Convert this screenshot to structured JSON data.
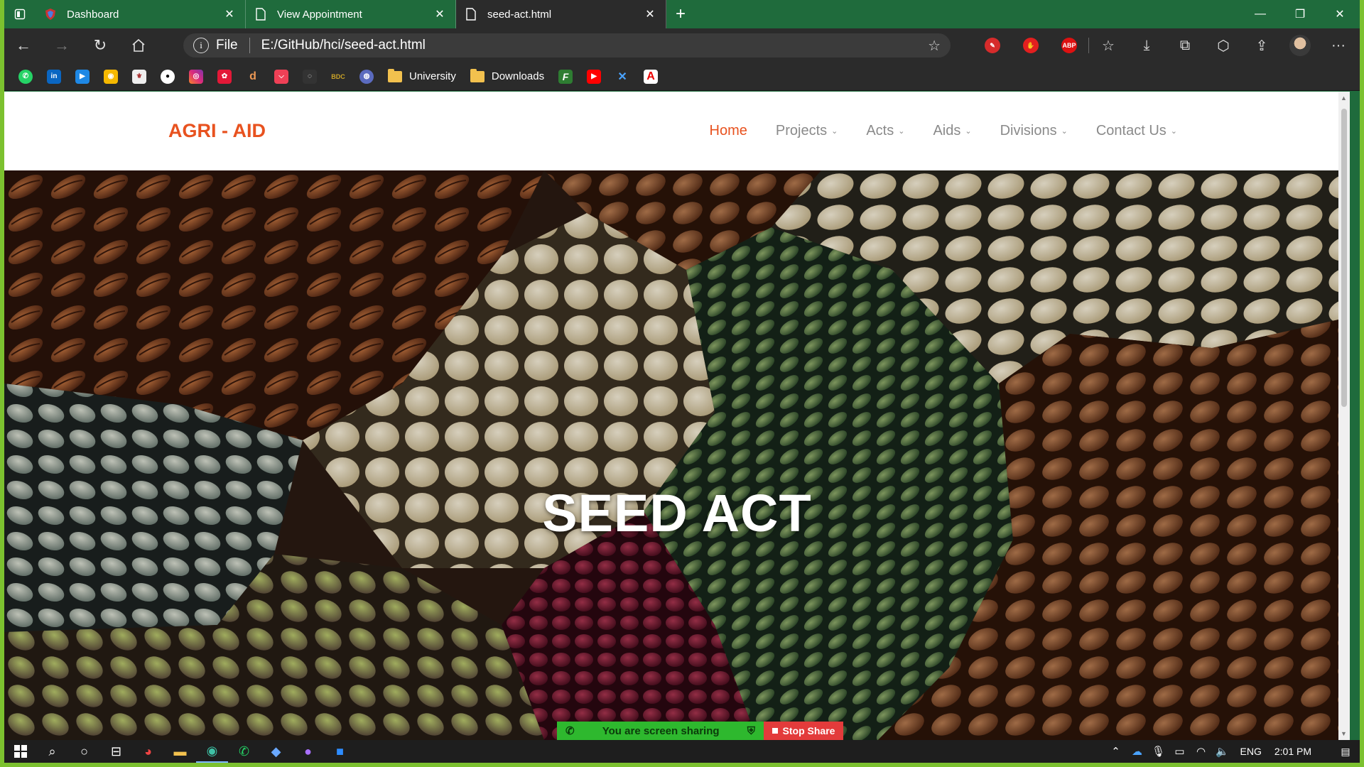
{
  "browser": {
    "tabs": [
      {
        "title": "Dashboard",
        "icon": "shield-icon",
        "active": false
      },
      {
        "title": "View Appointment",
        "icon": "document-icon",
        "active": false
      },
      {
        "title": "seed-act.html",
        "icon": "document-icon",
        "active": true
      }
    ],
    "address": {
      "scheme": "File",
      "url": "E:/GitHub/hci/seed-act.html"
    },
    "bookmarks": {
      "folders": [
        "University",
        "Downloads"
      ]
    }
  },
  "site": {
    "logo": "AGRI - AID",
    "nav": [
      {
        "label": "Home",
        "active": true,
        "dropdown": false
      },
      {
        "label": "Projects",
        "active": false,
        "dropdown": true
      },
      {
        "label": "Acts",
        "active": false,
        "dropdown": true
      },
      {
        "label": "Aids",
        "active": false,
        "dropdown": true
      },
      {
        "label": "Divisions",
        "active": false,
        "dropdown": true
      },
      {
        "label": "Contact Us",
        "active": false,
        "dropdown": true
      }
    ],
    "hero_title": "SEED ACT",
    "accent_color": "#e8521f"
  },
  "screenshare": {
    "message": "You are screen sharing",
    "stop_label": "Stop Share"
  },
  "taskbar": {
    "language": "ENG",
    "time": "2:01 PM"
  }
}
